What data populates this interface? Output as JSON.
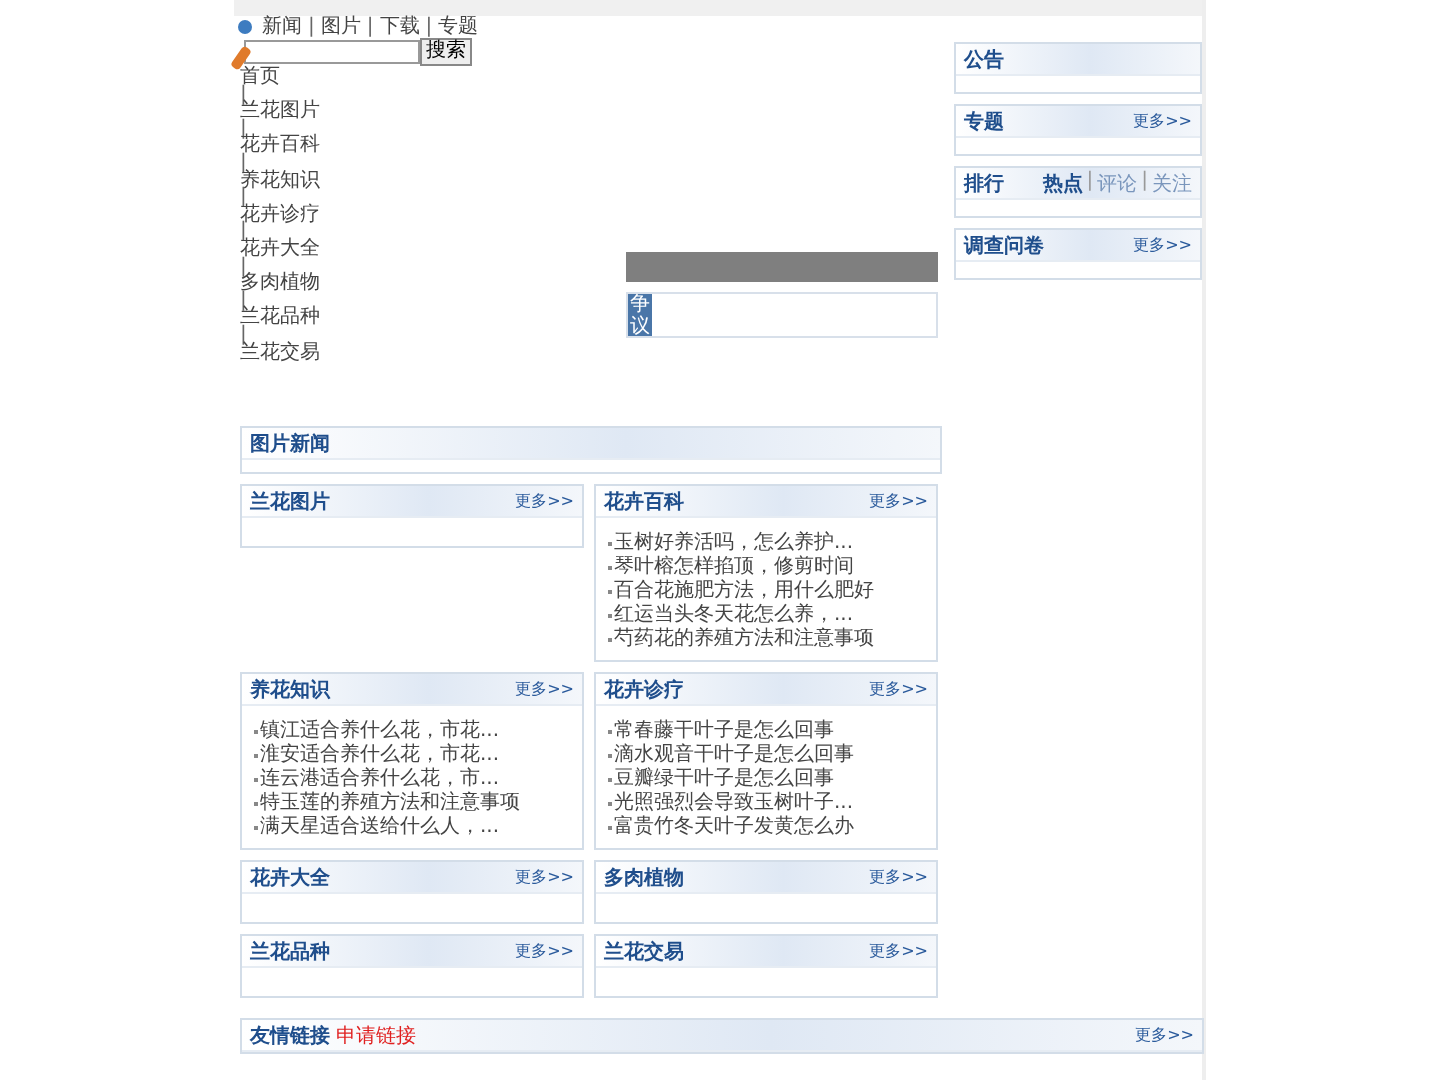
{
  "top_links": [
    {
      "kind": "link",
      "text": "新闻"
    },
    {
      "kind": "sep",
      "text": "|"
    },
    {
      "kind": "link",
      "text": "图片"
    },
    {
      "kind": "sep",
      "text": "|"
    },
    {
      "kind": "link",
      "text": "下载"
    },
    {
      "kind": "sep",
      "text": "|"
    },
    {
      "kind": "link",
      "text": "专题"
    }
  ],
  "search": {
    "button": "搜索"
  },
  "nav": [
    {
      "kind": "link",
      "text": "首页"
    },
    {
      "kind": "sep",
      "text": "|"
    },
    {
      "kind": "link",
      "text": "兰花图片"
    },
    {
      "kind": "sep",
      "text": "|"
    },
    {
      "kind": "link",
      "text": "花卉百科"
    },
    {
      "kind": "sep",
      "text": "|"
    },
    {
      "kind": "link",
      "text": "养花知识"
    },
    {
      "kind": "sep",
      "text": "|"
    },
    {
      "kind": "link",
      "text": "花卉诊疗"
    },
    {
      "kind": "sep",
      "text": "|"
    },
    {
      "kind": "link",
      "text": "花卉大全"
    },
    {
      "kind": "sep",
      "text": "|"
    },
    {
      "kind": "link",
      "text": "多肉植物"
    },
    {
      "kind": "sep",
      "text": "|"
    },
    {
      "kind": "link",
      "text": "兰花品种"
    },
    {
      "kind": "sep",
      "text": "|"
    },
    {
      "kind": "link",
      "text": "兰花交易"
    }
  ],
  "featured": {
    "badge": "争议"
  },
  "picture_news": {
    "title": "图片新闻"
  },
  "panels": [
    {
      "title": "兰花图片",
      "more": "更多>>"
    },
    {
      "title": "花卉百科",
      "more": "更多>>",
      "items": [
        "玉树好养活吗，怎么养护...",
        "琴叶榕怎样掐顶，修剪时间",
        "百合花施肥方法，用什么肥好",
        "红运当头冬天花怎么养，...",
        "芍药花的养殖方法和注意事项"
      ]
    },
    {
      "title": "养花知识",
      "more": "更多>>",
      "items": [
        "镇江适合养什么花，市花...",
        "淮安适合养什么花，市花...",
        "连云港适合养什么花，市...",
        "特玉莲的养殖方法和注意事项",
        "满天星适合送给什么人，..."
      ]
    },
    {
      "title": "花卉诊疗",
      "more": "更多>>",
      "items": [
        "常春藤干叶子是怎么回事",
        "滴水观音干叶子是怎么回事",
        "豆瓣绿干叶子是怎么回事",
        "光照强烈会导致玉树叶子...",
        "富贵竹冬天叶子发黄怎么办"
      ]
    },
    {
      "title": "花卉大全",
      "more": "更多>>"
    },
    {
      "title": "多肉植物",
      "more": "更多>>"
    },
    {
      "title": "兰花品种",
      "more": "更多>>"
    },
    {
      "title": "兰花交易",
      "more": "更多>>"
    }
  ],
  "sidebar": [
    {
      "title": "公告"
    },
    {
      "title": "专题",
      "more": "更多>>"
    },
    {
      "title": "排行",
      "tabs": [
        {
          "kind": "tab",
          "text": "热点",
          "selected": true
        },
        {
          "kind": "sep",
          "text": "|"
        },
        {
          "kind": "tab",
          "text": "评论",
          "selected": false
        },
        {
          "kind": "sep",
          "text": "|"
        },
        {
          "kind": "tab",
          "text": "关注",
          "selected": false
        }
      ]
    },
    {
      "title": "调查问卷",
      "more": "更多>>"
    }
  ],
  "links_box": {
    "title": "友情链接",
    "apply": "申请链接",
    "more": "更多>>"
  }
}
